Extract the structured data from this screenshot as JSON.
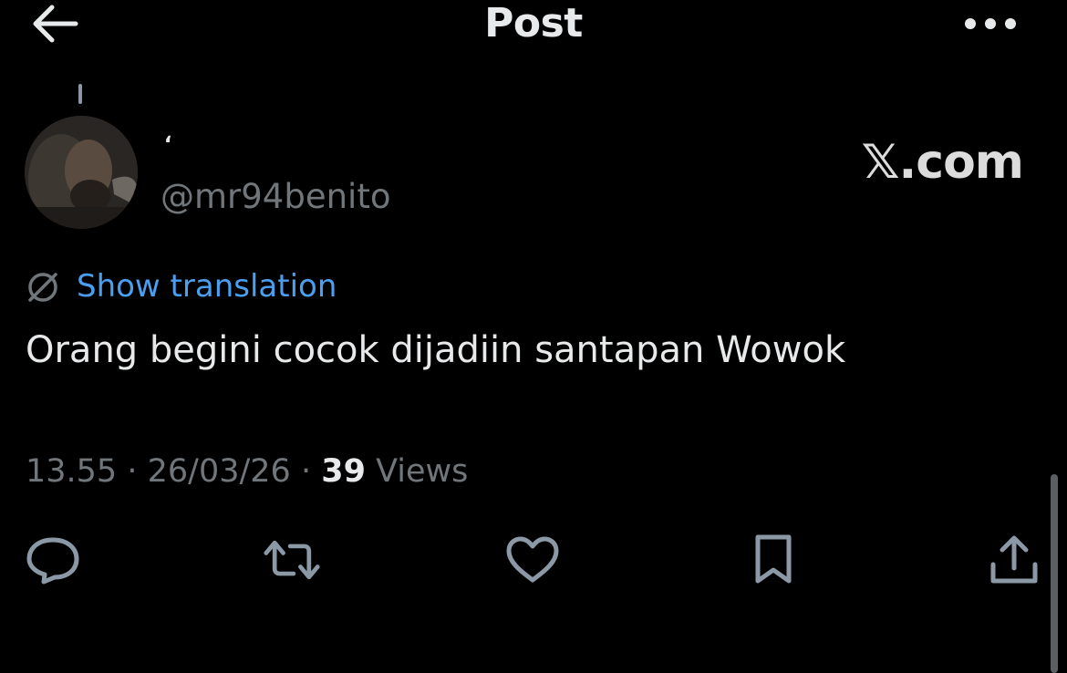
{
  "header": {
    "title": "Post",
    "back_icon": "arrow-left-icon",
    "more_icon": "more-horizontal-icon"
  },
  "post": {
    "author": {
      "display_name": "،",
      "handle": "@mr94benito"
    },
    "watermark": "𝕏.com",
    "translation_label": "Show translation",
    "text": "Orang begini cocok dijadiin santapan Wowok",
    "time": "13.55",
    "separator": "·",
    "date": "26/03/26",
    "views_count": "39",
    "views_label": "Views"
  },
  "actions": [
    {
      "name": "reply",
      "icon": "reply-icon"
    },
    {
      "name": "repost",
      "icon": "repost-icon"
    },
    {
      "name": "like",
      "icon": "heart-icon"
    },
    {
      "name": "bookmark",
      "icon": "bookmark-icon"
    },
    {
      "name": "share",
      "icon": "share-icon"
    }
  ],
  "colors": {
    "background": "#000000",
    "text_primary": "#e7e9ea",
    "text_secondary": "#71767b",
    "link": "#4b9ff0",
    "icon": "#8b98a5"
  }
}
